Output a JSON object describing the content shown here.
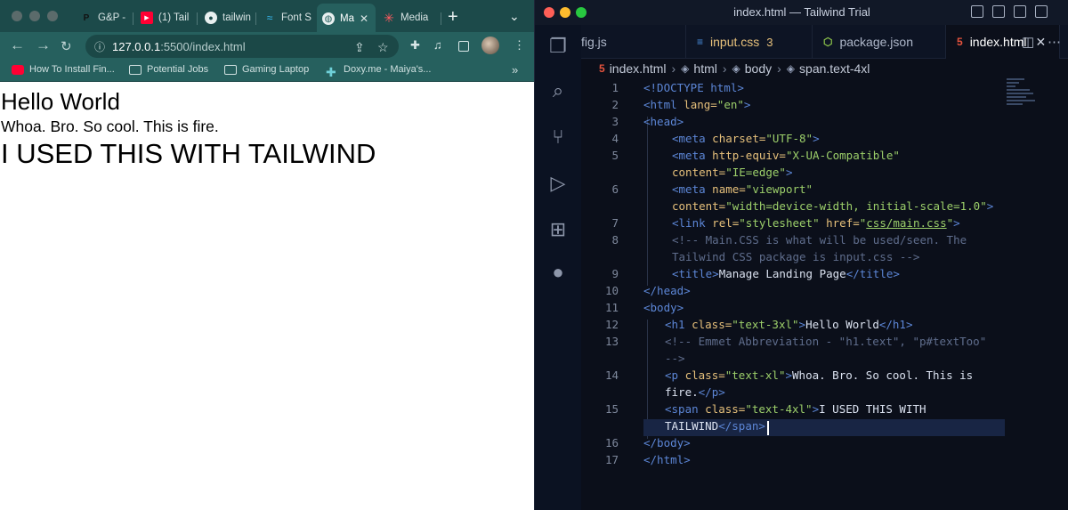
{
  "browser": {
    "tabs": [
      {
        "label": "G&P -",
        "icon": "pinterest-icon"
      },
      {
        "label": "(1) Tail",
        "icon": "youtube-icon"
      },
      {
        "label": "tailwin",
        "icon": "github-icon"
      },
      {
        "label": "Font S",
        "icon": "tailwind-icon"
      },
      {
        "label": "Ma",
        "icon": "globe-icon",
        "active": true
      },
      {
        "label": "Media",
        "icon": "asterisk-icon"
      }
    ],
    "url_host": "127.0.0.1",
    "url_path": ":5500/index.html",
    "bookmarks": [
      {
        "label": "How To Install Fin...",
        "icon": "youtube-icon"
      },
      {
        "label": "Potential Jobs",
        "icon": "folder-icon"
      },
      {
        "label": "Gaming Laptop",
        "icon": "folder-icon"
      },
      {
        "label": "Doxy.me - Maiya's...",
        "icon": "doxy-icon"
      }
    ],
    "page": {
      "h1": "Hello World",
      "p": "Whoa. Bro. So cool. This is fire.",
      "span": "I USED THIS WITH TAILWIND"
    }
  },
  "editor": {
    "window_title": "index.html — Tailwind Trial",
    "tabs": [
      {
        "label": "fig.js",
        "icon": ""
      },
      {
        "label": "input.css",
        "icon": "css-icon",
        "badge": "3"
      },
      {
        "label": "package.json",
        "icon": "npm-icon"
      },
      {
        "label": "index.html",
        "icon": "html5-icon",
        "active": true
      }
    ],
    "breadcrumbs": [
      "index.html",
      "html",
      "body",
      "span.text-4xl"
    ],
    "line_numbers": [
      "1",
      "2",
      "3",
      "4",
      "5",
      "6",
      "7",
      "8",
      "9",
      "10",
      "11",
      "12",
      "13",
      "14",
      "15",
      "16",
      "17"
    ],
    "code": {
      "l1": "<!DOCTYPE html>",
      "l2_tag": "<html",
      "l2_attr": " lang=",
      "l2_str": "\"en\"",
      "l2_end": ">",
      "l3": "<head>",
      "l4_tag": "<meta",
      "l4_attr": " charset=",
      "l4_str": "\"UTF-8\"",
      "l4_end": ">",
      "l5_tag": "<meta",
      "l5_attr": " http-equiv=",
      "l5_str": "\"X-UA-Compatible\"",
      "l5b_attr": "content=",
      "l5b_str": "\"IE=edge\"",
      "l5b_end": ">",
      "l6_tag": "<meta",
      "l6_attr": " name=",
      "l6_str": "\"viewport\"",
      "l6b_attr": "content=",
      "l6b_str": "\"width=device-width, initial-scale=1.0\"",
      "l6b_end": ">",
      "l7_tag": "<link",
      "l7_attr1": " rel=",
      "l7_str1": "\"stylesheet\"",
      "l7_attr2": " href=",
      "l7_q1": "\"",
      "l7_str2": "css/main.css",
      "l7_q2": "\"",
      "l7_end": ">",
      "l8": "<!-- Main.CSS is what will be used/seen. The",
      "l8b": "Tailwind CSS package is input.css -->",
      "l9_tag": "<title>",
      "l9_text": "Manage Landing Page",
      "l9_end": "</title>",
      "l10": "</head>",
      "l11": "<body>",
      "l12_tag": "<h1",
      "l12_attr": " class=",
      "l12_str": "\"text-3xl\"",
      "l12_gt": ">",
      "l12_text": "Hello World",
      "l12_end": "</h1>",
      "l13": "<!-- Emmet Abbreviation - \"h1.text\", \"p#textToo\"",
      "l13b": "-->",
      "l14_tag": "<p",
      "l14_attr": " class=",
      "l14_str": "\"text-xl\"",
      "l14_gt": ">",
      "l14_text": "Whoa. Bro. So cool. This is",
      "l14b_text": "fire.",
      "l14b_end": "</p>",
      "l15_tag": "<span",
      "l15_attr": " class=",
      "l15_str": "\"text-4xl\"",
      "l15_gt": ">",
      "l15_text": "I USED THIS WITH",
      "l15b_text": "TAILWIND",
      "l15b_end": "</span>",
      "l16": "</body>",
      "l17": "</html>"
    }
  }
}
